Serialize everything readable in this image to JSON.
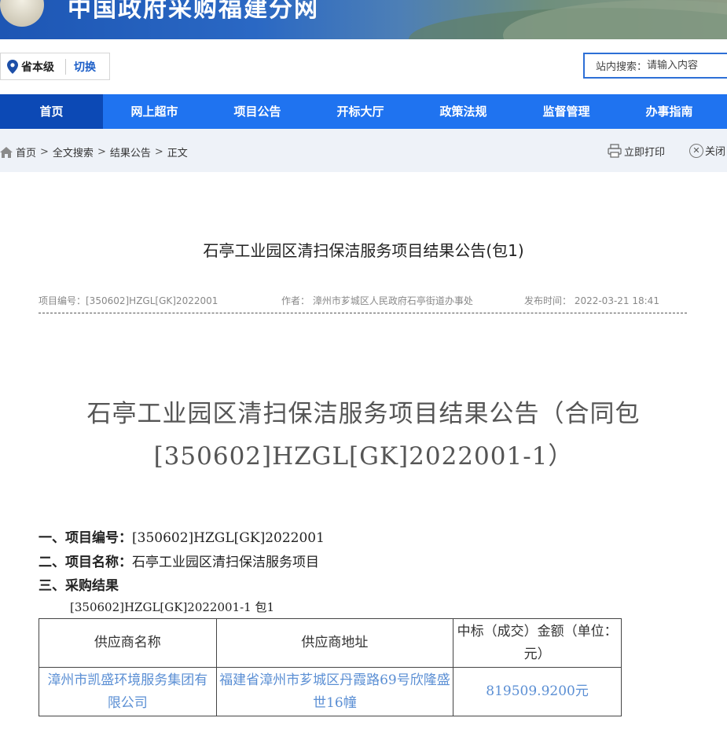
{
  "site": {
    "title": "中国政府采购福建分网"
  },
  "region": {
    "level": "省本级",
    "switch_label": "切换"
  },
  "search": {
    "label": "站内搜索：",
    "placeholder": "请输入内容"
  },
  "nav": {
    "items": [
      {
        "label": "首页"
      },
      {
        "label": "网上超市"
      },
      {
        "label": "项目公告"
      },
      {
        "label": "开标大厅"
      },
      {
        "label": "政策法规"
      },
      {
        "label": "监督管理"
      },
      {
        "label": "办事指南"
      }
    ]
  },
  "breadcrumb": {
    "items": [
      "首页",
      "全文搜索",
      "结果公告",
      "正文"
    ],
    "separator": ">"
  },
  "toolbar": {
    "print_label": "立即打印",
    "close_label": "关闭"
  },
  "article": {
    "title": "石亭工业园区清扫保洁服务项目结果公告(包1)",
    "meta": {
      "project_no": "项目编号：[350602]HZGL[GK]2022001",
      "author": "作者：  漳州市芗城区人民政府石亭街道办事处",
      "publish_time": "发布时间：  2022-03-21 18:41"
    },
    "doc_title_line1": "石亭工业园区清扫保洁服务项目结果公告（合同包",
    "doc_title_line2": "[350602]HZGL[GK]2022001-1）",
    "sections": {
      "s1_label": "一、项目编号：",
      "s1_value": "[350602]HZGL[GK]2022001",
      "s2_label": "二、项目名称：",
      "s2_value": "石亭工业园区清扫保洁服务项目",
      "s3_label": "三、采购结果"
    },
    "package_line": "[350602]HZGL[GK]2022001-1 包1",
    "table": {
      "headers": [
        "供应商名称",
        "供应商地址",
        "中标（成交）金额（单位：元）"
      ],
      "rows": [
        [
          "漳州市凯盛环境服务集团有限公司",
          "福建省漳州市芗城区丹霞路69号欣隆盛世16幢",
          "819509.9200元"
        ]
      ]
    }
  },
  "colors": {
    "nav_bg": "#1f73f0",
    "nav_active": "#0c49b5",
    "link_blue": "#5b8fd4"
  }
}
